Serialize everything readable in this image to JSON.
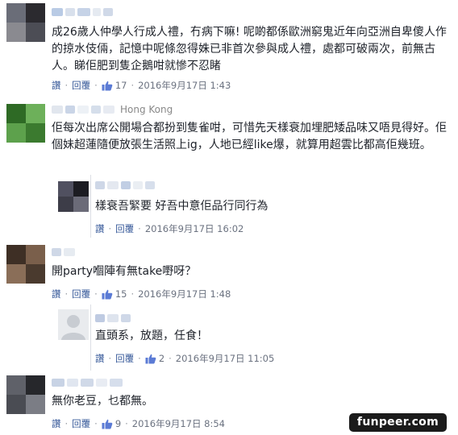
{
  "labels": {
    "reply": "讚",
    "respond": "回覆",
    "sep": "·"
  },
  "comments": [
    {
      "location": "",
      "text": "成26歲人仲學人行成人禮，冇病下嘛! 呢啲都係歐洲窮鬼近年向亞洲自卑傻人作的掠水伎倆，記憶中呢條忽得姝已非首次參與成人禮，處都可破兩次，前無古人。睇佢肥到隻企鵝咁就慘不忍睹",
      "likes": "17",
      "date": "2016年9月17日 1:43"
    },
    {
      "location": "Hong Kong",
      "text": "佢每次出席公開場合都扮到隻雀咁，可惜先天樣衰加埋肥矮品味又唔見得好。佢個妹超蓮隨便放張生活照上ig，人地已經like爆，就算用超雲比都高佢幾班。",
      "likes": "",
      "date": ""
    },
    {
      "location": "",
      "text": "樣衰吾緊要 好吾中意佢品行同行為",
      "likes": "",
      "date": "2016年9月17日 16:02"
    },
    {
      "location": "",
      "text": "開party嗰陣有無take嘢呀？",
      "likes": "15",
      "date": "2016年9月17日 1:48"
    },
    {
      "location": "",
      "text": "直頭系，放題，任食！",
      "likes": "2",
      "date": "2016年9月17日 11:05"
    },
    {
      "location": "",
      "text": "無你老豆，乜都無。",
      "likes": "9",
      "date": "2016年9月17日 8:54"
    }
  ],
  "watermark": "funpeer.com",
  "colors": {
    "link": "#365899",
    "meta": "#6b7280",
    "text": "#1d2129"
  }
}
